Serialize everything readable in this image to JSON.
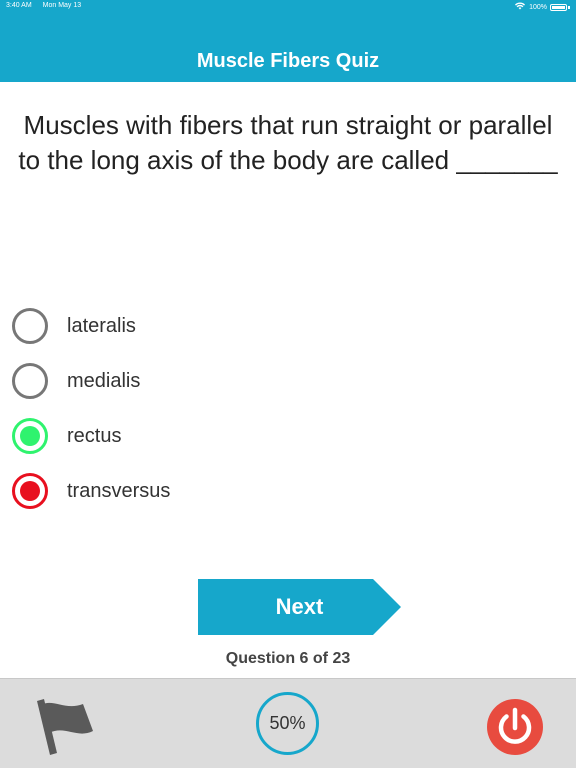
{
  "status_bar": {
    "time": "3:40 AM",
    "date": "Mon May 13",
    "battery": "100%"
  },
  "header": {
    "title": "Muscle Fibers Quiz"
  },
  "question": {
    "line1": "Muscles with fibers that run straight or parallel",
    "line2": "to the long axis of the body are called _______"
  },
  "options": [
    {
      "label": "lateralis",
      "state": "unselected"
    },
    {
      "label": "medialis",
      "state": "unselected"
    },
    {
      "label": "rectus",
      "state": "correct"
    },
    {
      "label": "transversus",
      "state": "incorrect"
    }
  ],
  "next_button": {
    "label": "Next"
  },
  "progress": {
    "text": "Question 6 of 23"
  },
  "footer": {
    "score": "50%",
    "icons": [
      "flag-icon",
      "power-icon"
    ]
  },
  "colors": {
    "accent": "#16a7cb",
    "correct": "#2ff36e",
    "incorrect": "#e8101f",
    "power": "#e84b3f"
  }
}
